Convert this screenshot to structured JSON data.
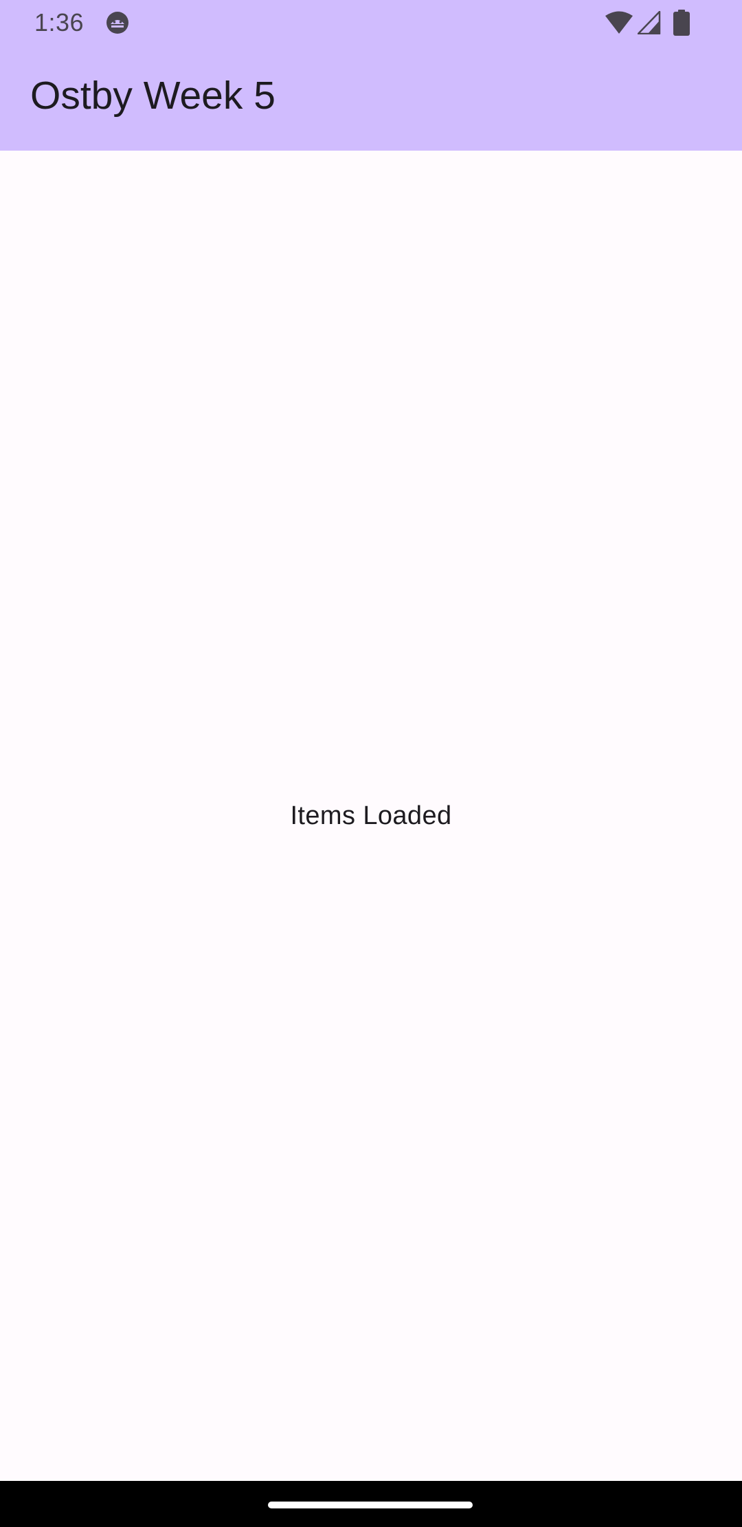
{
  "status_bar": {
    "time": "1:36",
    "icon_color": "#49454f",
    "icons": [
      "android-app-icon",
      "wifi-icon",
      "cellular-signal-icon",
      "battery-icon"
    ]
  },
  "app_bar": {
    "title": "Ostby Week 5",
    "background_color": "#d0bcfe"
  },
  "main": {
    "status_message": "Items Loaded",
    "background_color": "#fffbfe"
  },
  "navigation_bar": {
    "background_color": "#000000",
    "handle_color": "#ffffff"
  }
}
